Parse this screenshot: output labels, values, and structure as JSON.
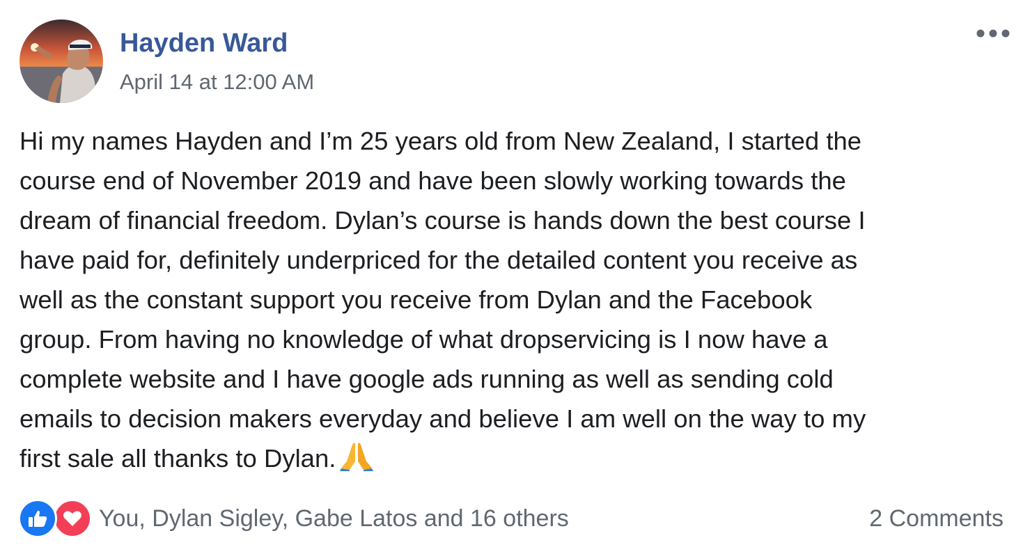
{
  "post": {
    "author": "Hayden Ward",
    "timestamp": "April 14 at 12:00 AM",
    "more_icon": "ellipsis-icon",
    "body_lines": [
      "Hi my names Hayden and I’m 25 years old from New Zealand, I started the",
      "course end of November 2019 and have been slowly working towards the",
      "dream of financial freedom. Dylan’s course is hands down the best course I",
      "have paid for, definitely underpriced for the detailed content you receive as",
      "well as the constant support you receive from Dylan and the Facebook",
      "group. From having no knowledge of what dropservicing is I now have a",
      "complete website and I have google ads running as well as sending cold",
      "emails to decision makers everyday and believe I am well on the way to my",
      "first sale all thanks to Dylan."
    ],
    "emoji": "folded-hands-emoji"
  },
  "reactions": {
    "icons": [
      "like-icon",
      "love-icon"
    ],
    "summary": "You, Dylan Sigley, Gabe Latos and 16 others",
    "comments": "2 Comments"
  },
  "colors": {
    "author_link": "#385898",
    "secondary_text": "#616770",
    "body_text": "#1c1e21",
    "like_blue": "#1877f2",
    "love_red": "#f33e58"
  }
}
